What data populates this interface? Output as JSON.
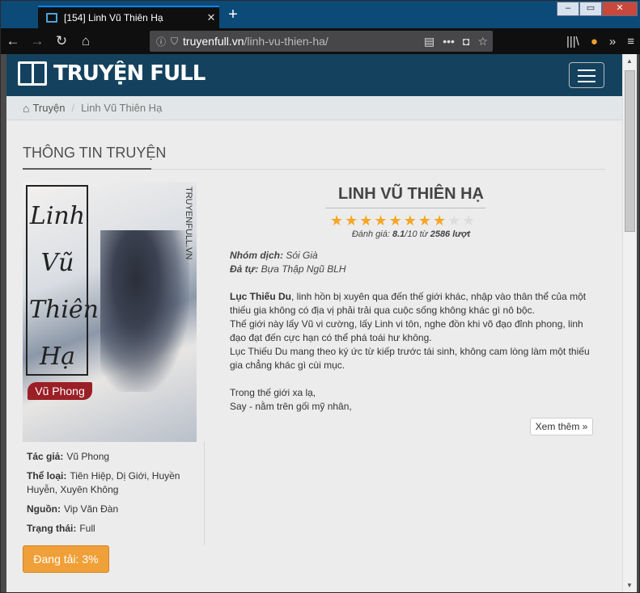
{
  "browser": {
    "tab_title": "[154] Linh Vũ Thiên Hạ",
    "url_host": "truyenfull.vn",
    "url_path": "/linh-vu-thien-ha/"
  },
  "site": {
    "logo_text": "TRUYỆN FULL"
  },
  "breadcrumb": {
    "home": "Truyện",
    "current": "Linh Vũ Thiên Hạ"
  },
  "section": {
    "title": "THÔNG TIN TRUYỆN"
  },
  "cover": {
    "vertical_title": "Linh Vũ Thiên Hạ",
    "site_mark": "TRUYENFULL.VN",
    "author_badge": "Vũ Phong"
  },
  "meta": {
    "author_label": "Tác giả:",
    "author": "Vũ Phong",
    "genre_label": "Thể loại:",
    "genre": "Tiên Hiệp, Dị Giới, Huyền Huyễn, Xuyên Không",
    "source_label": "Nguồn:",
    "source": "Vip Văn Đàn",
    "status_label": "Trạng thái:",
    "status": "Full"
  },
  "download": {
    "label": "Đang tải: 3%",
    "progress": 0.03
  },
  "story": {
    "title": "LINH VŨ THIÊN HẠ",
    "rating_value": 8.1,
    "rating_max": 10,
    "rating_count": 2586,
    "rating_prefix": "Đánh giá: ",
    "rating_value_text": "8.1",
    "rating_of": "/10 từ ",
    "rating_count_text": "2586 lượt",
    "translator_label": "Nhóm dịch:",
    "translator": "Sói Già",
    "editor_label": "Đả tự:",
    "editor": "Bựa Thập Ngũ BLH",
    "desc_name": "Lục Thiếu Du",
    "desc_1": ", linh hồn bị xuyên qua đến thế giới khác, nhập vào thân thể của một thiếu gia không có địa vị phải trải qua cuộc sống không khác gì nô bộc.",
    "desc_2": "Thế giới này lấy Vũ vi cường, lấy Linh vi tôn, nghe đồn khi võ đạo đỉnh phong, linh đạo đạt đến cực hạn có thể phá toái hư không.",
    "desc_3": "Lục Thiếu Du mang theo ký ức từ kiếp trước tái sinh, không cam lòng làm một thiếu gia chẳng khác gì cùi mục.",
    "desc_4": "Trong thế giới xa lạ,",
    "desc_5": "Say - nằm trên gối mỹ nhân,",
    "more_label": "Xem thêm »"
  },
  "colors": {
    "header_bg": "#14425e",
    "star_on": "#f5a623",
    "download_btn": "#f0a038"
  }
}
